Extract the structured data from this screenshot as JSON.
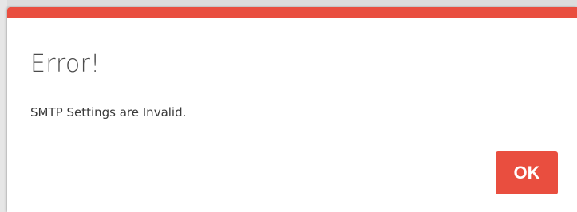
{
  "dialog": {
    "title": "Error!",
    "message": "SMTP Settings are Invalid.",
    "ok_label": "OK"
  },
  "colors": {
    "accent": "#e94e3f",
    "button_text": "#ffffff",
    "title_text": "#4a4a4a"
  }
}
